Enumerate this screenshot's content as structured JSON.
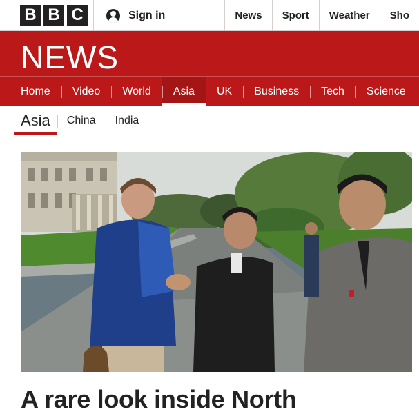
{
  "topbar": {
    "logo_letters": [
      "B",
      "B",
      "C"
    ],
    "signin_label": "Sign in",
    "nav": [
      "News",
      "Sport",
      "Weather",
      "Sho"
    ]
  },
  "news_header": {
    "title": "NEWS",
    "nav": [
      "Home",
      "Video",
      "World",
      "Asia",
      "UK",
      "Business",
      "Tech",
      "Science"
    ],
    "active": "Asia"
  },
  "subnav": {
    "current": "Asia",
    "items": [
      "China",
      "India"
    ]
  },
  "article": {
    "headline": "A rare look inside North"
  },
  "colors": {
    "brand_red": "#bb1919",
    "dark": "#222222"
  }
}
